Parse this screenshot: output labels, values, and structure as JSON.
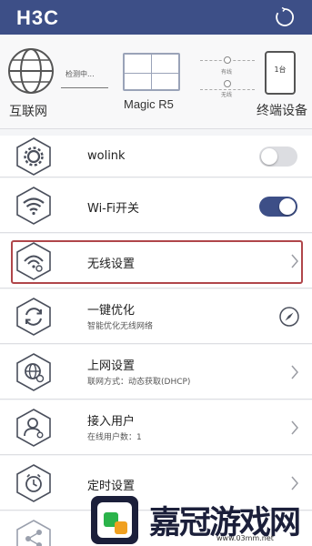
{
  "header": {
    "logo": "H3C",
    "icons": [
      "refresh-icon"
    ]
  },
  "topology": {
    "internet_label": "互联网",
    "detect_status": "检测中...",
    "router_model": "Magic R5",
    "wired_label": "有线",
    "wireless_label": "无线",
    "device_count": "1台",
    "terminal_label": "终端设备"
  },
  "list": {
    "items": [
      {
        "title": "wolink",
        "subtitle": "",
        "control": "toggle",
        "toggle_on": false,
        "icon": "gear-icon"
      },
      {
        "title": "Wi-Fi开关",
        "subtitle": "",
        "control": "toggle",
        "toggle_on": true,
        "icon": "wifi-icon"
      },
      {
        "title": "无线设置",
        "subtitle": "",
        "control": "chevron",
        "highlighted": true,
        "icon": "wireless-settings-icon"
      },
      {
        "title": "一键优化",
        "subtitle": "智能优化无线网络",
        "control": "compass",
        "icon": "optimize-icon"
      },
      {
        "title": "上网设置",
        "subtitle": "联网方式：动态获取(DHCP)",
        "control": "chevron",
        "icon": "globe-settings-icon"
      },
      {
        "title": "接入用户",
        "subtitle": "在线用户数：1",
        "control": "chevron",
        "icon": "user-icon"
      },
      {
        "title": "定时设置",
        "subtitle": "",
        "control": "chevron",
        "icon": "timer-icon"
      },
      {
        "title": "",
        "subtitle": "",
        "control": "none",
        "icon": "share-icon"
      }
    ]
  },
  "watermark": {
    "text": "嘉冠游戏网",
    "url": "www.03mm.net"
  },
  "colors": {
    "header_bg": "#3d4f87",
    "toggle_on": "#3d4f87",
    "toggle_off": "#dcdde1",
    "highlight": "#b0464a"
  }
}
